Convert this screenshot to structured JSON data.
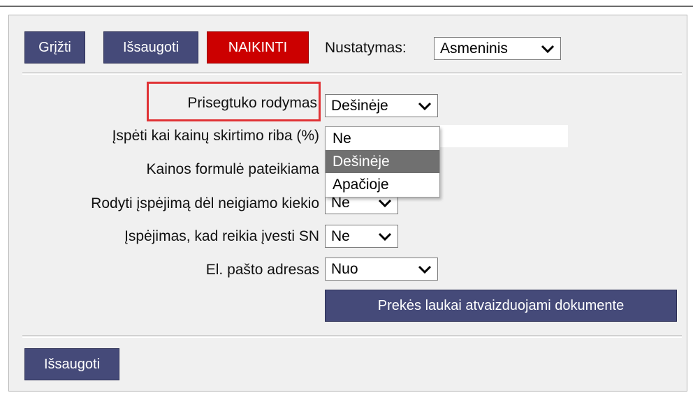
{
  "toolbar": {
    "back_label": "Grįžti",
    "save_label": "Išsaugoti",
    "delete_label": "NAIKINTI",
    "settings_label": "Nustatymas:",
    "settings_value": "Asmeninis"
  },
  "form": {
    "fields": [
      {
        "label": "Prisegtuko rodymas",
        "value": "Dešinėje"
      },
      {
        "label": "Įspėti kai kainų skirtimo riba (%)",
        "value": ""
      },
      {
        "label": "Kainos formulė pateikiama",
        "value": ""
      },
      {
        "label": "Rodyti įspėjimą dėl neigiamo kiekio",
        "value": "Ne"
      },
      {
        "label": "Įspėjimas, kad reikia įvesti SN",
        "value": "Ne"
      },
      {
        "label": "El. pašto adresas",
        "value": "Nuo"
      }
    ],
    "item_fields_button": "Prekės laukai atvaizduojami dokumente"
  },
  "dropdown": {
    "options": [
      "Ne",
      "Dešinėje",
      "Apačioje"
    ],
    "selected": "Dešinėje"
  },
  "footer": {
    "save_label": "Išsaugoti"
  },
  "colors": {
    "button_bg": "#454a79",
    "delete_bg": "#cc0000",
    "highlight_border": "#e03235",
    "panel_bg": "#f0f0f0"
  }
}
